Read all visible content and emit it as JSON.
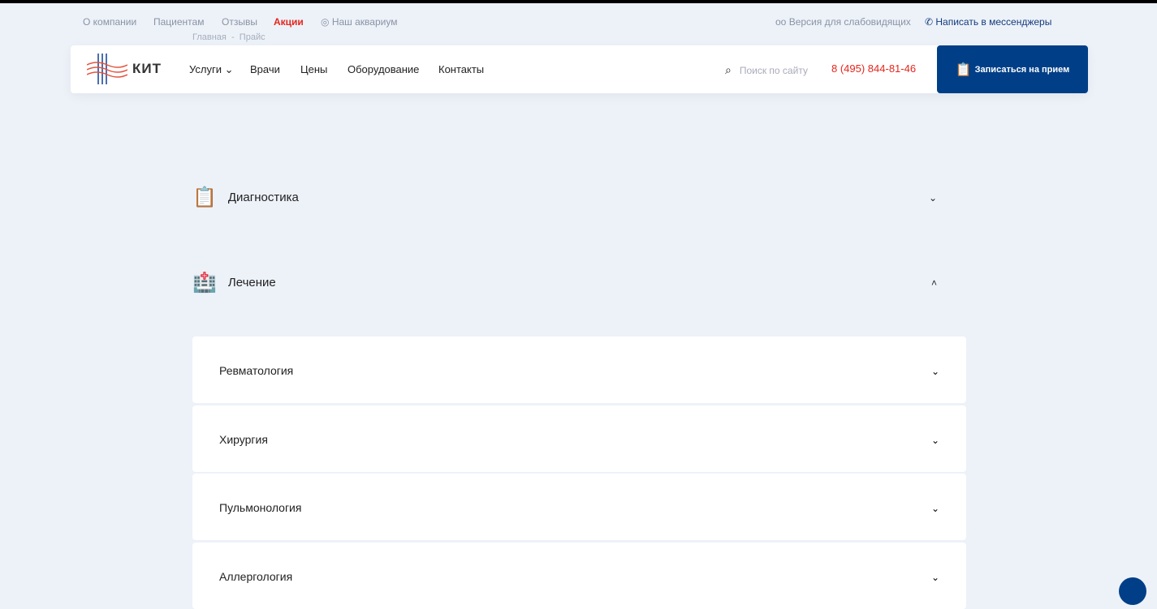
{
  "topbar": {
    "links": [
      "О компании",
      "Пациентам",
      "Отзывы",
      "Акции",
      "Наш аквариум"
    ],
    "accessibility": "Версия для слабовидящих",
    "messenger": "Написать в мессенджеры"
  },
  "breadcrumb": [
    "Главная",
    "-",
    "Прайс"
  ],
  "header": {
    "logo": "КИТ",
    "nav": [
      "Услуги",
      "Врачи",
      "Цены",
      "Оборудование",
      "Контакты"
    ],
    "search_placeholder": "Поиск по сайту",
    "phone": "8 (495) 844-81-46",
    "cta": "Записаться на прием"
  },
  "categories": [
    {
      "label": "Диагностика"
    },
    {
      "label": "Лечение"
    }
  ],
  "items": [
    "Ревматология",
    "Хирургия",
    "Пульмонология",
    "Аллергология"
  ],
  "colors": {
    "accent": "#003f87",
    "red": "#e5261d"
  }
}
